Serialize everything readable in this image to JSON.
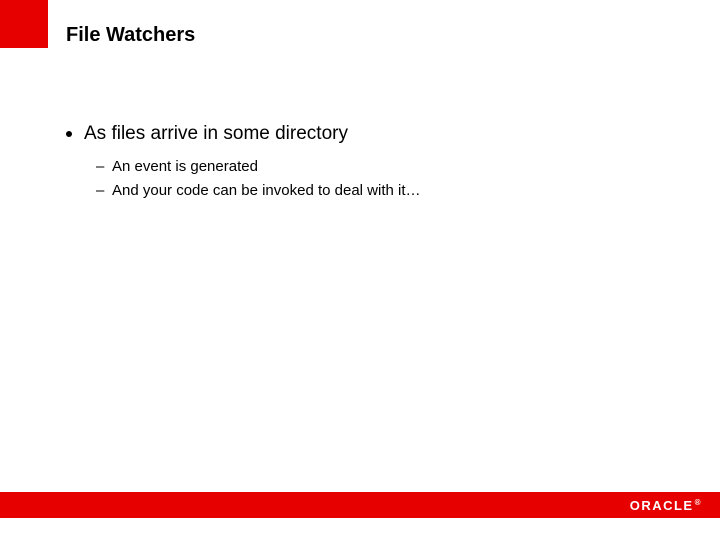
{
  "title": "File Watchers",
  "bullets": [
    {
      "text": "As files arrive in some directory",
      "sub": [
        "An event is generated",
        "And your code can be invoked to deal with it…"
      ]
    }
  ],
  "footer": {
    "logo": "ORACLE",
    "reg": "®"
  }
}
